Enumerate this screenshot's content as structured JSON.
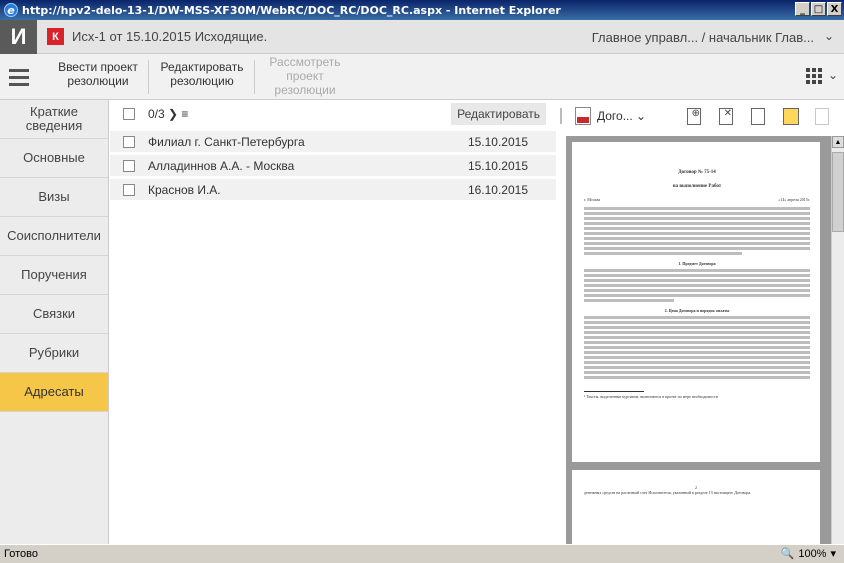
{
  "window": {
    "title": "http://hpv2-delo-13-1/DW-MSS-XF30M/WebRC/DOC_RC/DOC_RC.aspx - Internet Explorer",
    "controls": [
      "_",
      "□",
      "X"
    ]
  },
  "header": {
    "brand": "И",
    "badge": "К",
    "doc_title": "Исх-1 от 15.10.2015  Исходящие.",
    "user": "Главное управл... / начальник Глав...",
    "user_chevron": "⌄"
  },
  "toolbar": {
    "enter_project_1": "Ввести проект",
    "enter_project_2": "резолюции",
    "edit_res_1": "Редактировать",
    "edit_res_2": "резолюцию",
    "review_1": "Рассмотреть",
    "review_2": "проект",
    "review_3": "резолюции",
    "apps_chevron": "⌄"
  },
  "sidebar": {
    "items": [
      {
        "label_1": "Краткие",
        "label_2": "сведения"
      },
      {
        "label_1": "Основные",
        "label_2": ""
      },
      {
        "label_1": "Визы",
        "label_2": ""
      },
      {
        "label_1": "Соисполнители",
        "label_2": ""
      },
      {
        "label_1": "Поручения",
        "label_2": ""
      },
      {
        "label_1": "Связки",
        "label_2": ""
      },
      {
        "label_1": "Рубрики",
        "label_2": ""
      },
      {
        "label_1": "Адресаты",
        "label_2": ""
      }
    ],
    "active_index": 7
  },
  "list": {
    "counter": "0/3  ❯ ≡",
    "edit_label": "Редактировать",
    "rows": [
      {
        "name": "Филиал г. Санкт-Петербурга",
        "date": "15.10.2015"
      },
      {
        "name": "Алладиннов А.А. - Москва",
        "date": "15.10.2015"
      },
      {
        "name": "Краснов И.А.",
        "date": "16.10.2015"
      }
    ]
  },
  "viewer": {
    "doc_select": "Дого...  ⌄",
    "page": {
      "title_1": "Договор № 75-14",
      "title_2": "на выполнение Работ",
      "city": "г. Москва",
      "date": "«14» апреля 2015г.",
      "section_1": "1. Предмет Договора",
      "section_2": "2. Цена Договора и порядок оплаты",
      "footnote": "¹ Тексты, выделенные курсивом, включаются в проект по мере необходимости",
      "page2_number": "2",
      "page2_text": "денежных средств на расчетный счет Исполнителя, указанный в разделе 13 настоящего Договора."
    }
  },
  "status": {
    "text": "Готово",
    "zoom": "100%"
  },
  "colors": {
    "active_tab": "#f5c648",
    "brand_bg": "#5a5a5a",
    "badge_red": "#d9222a"
  }
}
